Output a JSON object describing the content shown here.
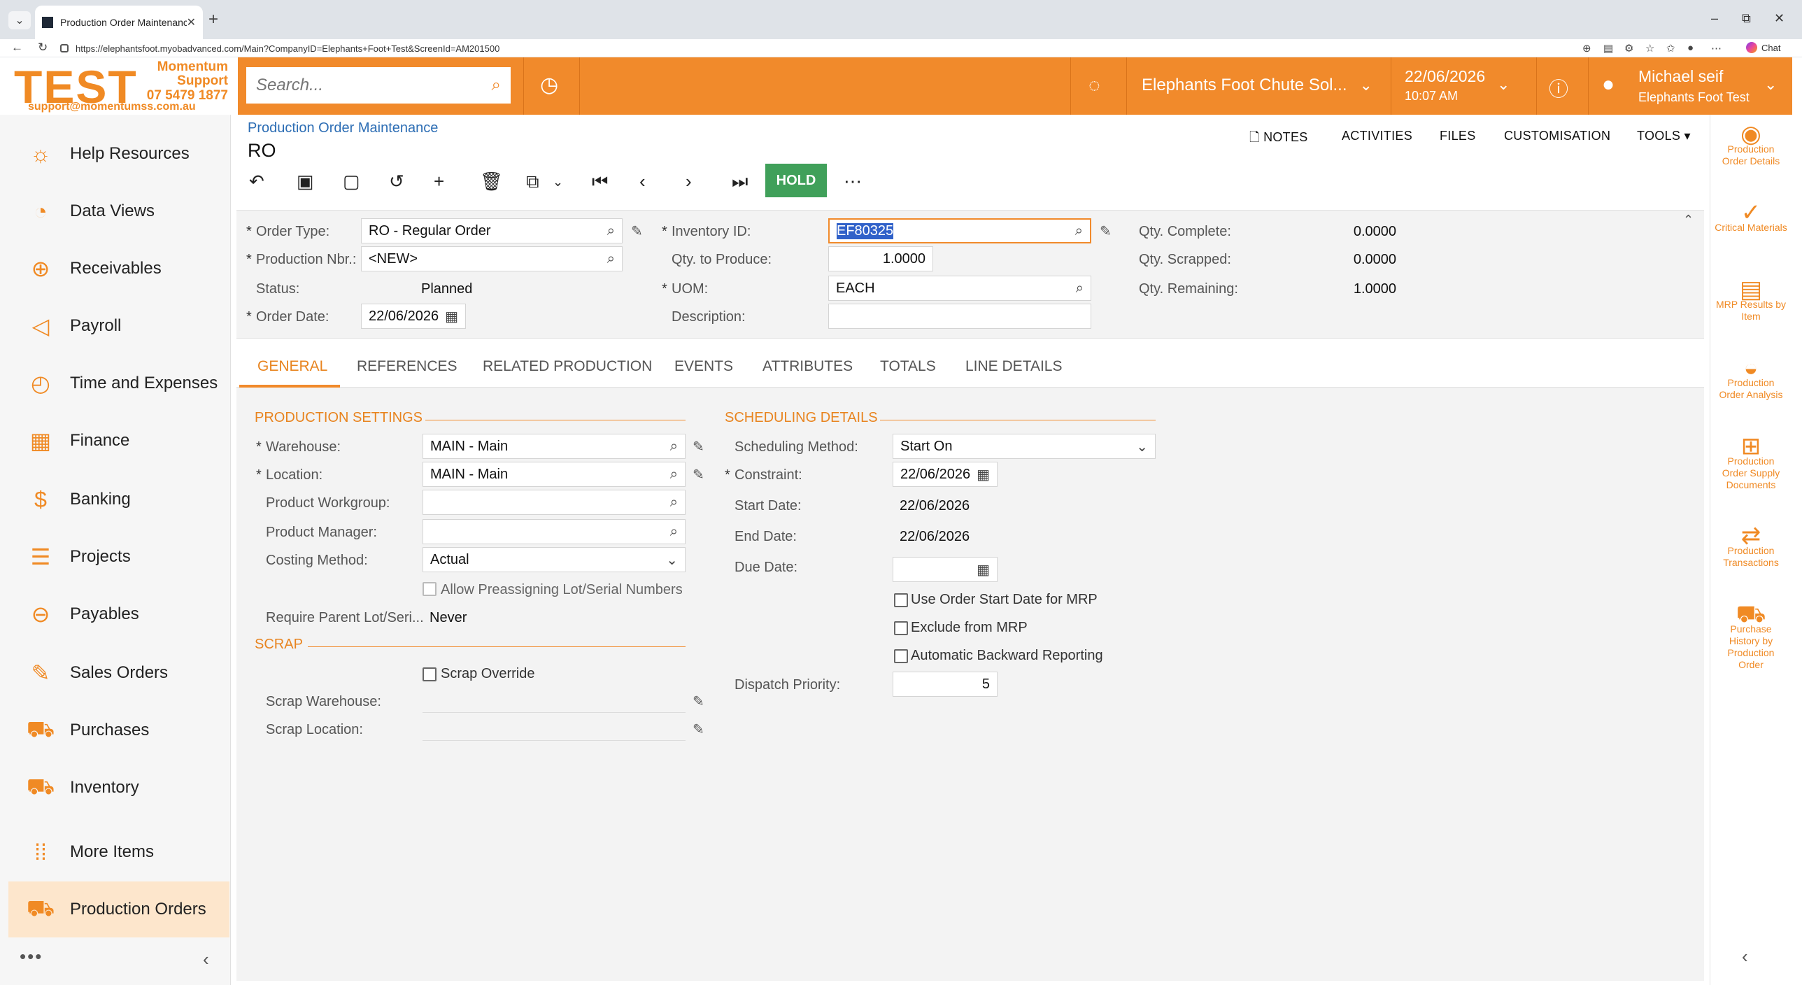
{
  "browser": {
    "tab_title": "Production Order Maintenance",
    "url": "https://elephantsfoot.myobadvanced.com/Main?CompanyID=Elephants+Foot+Test&ScreenId=AM201500",
    "chat_label": "Chat"
  },
  "logo": {
    "brand": "TEST",
    "line1": "Momentum",
    "line2": "Support",
    "phone": "07 5479 1877",
    "email": "support@momentumss.com.au"
  },
  "header": {
    "search_placeholder": "Search...",
    "company": "Elephants Foot Chute Sol...",
    "date": "22/06/2026",
    "time": "10:07 AM",
    "user_name": "Michael seif",
    "user_company": "Elephants Foot Test"
  },
  "sidebar": {
    "items": [
      {
        "label": "Help Resources",
        "icon": "lightbulb-icon"
      },
      {
        "label": "Data Views",
        "icon": "pie-chart-icon"
      },
      {
        "label": "Receivables",
        "icon": "plus-circle-icon"
      },
      {
        "label": "Payroll",
        "icon": "megaphone-icon"
      },
      {
        "label": "Time and Expenses",
        "icon": "stopwatch-icon"
      },
      {
        "label": "Finance",
        "icon": "calculator-icon"
      },
      {
        "label": "Banking",
        "icon": "dollar-icon"
      },
      {
        "label": "Projects",
        "icon": "projects-icon"
      },
      {
        "label": "Payables",
        "icon": "minus-circle-icon"
      },
      {
        "label": "Sales Orders",
        "icon": "edit-icon"
      },
      {
        "label": "Purchases",
        "icon": "cart-icon"
      },
      {
        "label": "Inventory",
        "icon": "truck-icon"
      },
      {
        "label": "More Items",
        "icon": "grid-icon"
      },
      {
        "label": "Production Orders",
        "icon": "truck-icon"
      }
    ],
    "more": "•••"
  },
  "page": {
    "breadcrumb": "Production Order Maintenance",
    "title": "RO",
    "links": {
      "notes": "NOTES",
      "activities": "ACTIVITIES",
      "files": "FILES",
      "customisation": "CUSTOMISATION",
      "tools": "TOOLS"
    },
    "hold_label": "HOLD"
  },
  "summary": {
    "order_type_label": "Order Type:",
    "order_type": "RO - Regular Order",
    "production_nbr_label": "Production Nbr.:",
    "production_nbr": "<NEW>",
    "status_label": "Status:",
    "status": "Planned",
    "order_date_label": "Order Date:",
    "order_date": "22/06/2026",
    "inventory_id_label": "Inventory ID:",
    "inventory_id": "EF80325",
    "qty_to_produce_label": "Qty. to Produce:",
    "qty_to_produce": "1.0000",
    "uom_label": "UOM:",
    "uom": "EACH",
    "description_label": "Description:",
    "description": "",
    "qty_complete_label": "Qty. Complete:",
    "qty_complete": "0.0000",
    "qty_scrapped_label": "Qty. Scrapped:",
    "qty_scrapped": "0.0000",
    "qty_remaining_label": "Qty. Remaining:",
    "qty_remaining": "1.0000"
  },
  "tabs": [
    "GENERAL",
    "REFERENCES",
    "RELATED PRODUCTION",
    "EVENTS",
    "ATTRIBUTES",
    "TOTALS",
    "LINE DETAILS"
  ],
  "production_settings": {
    "header": "PRODUCTION SETTINGS",
    "warehouse_label": "Warehouse:",
    "warehouse": "MAIN - Main",
    "location_label": "Location:",
    "location": "MAIN - Main",
    "workgroup_label": "Product Workgroup:",
    "workgroup": "",
    "manager_label": "Product Manager:",
    "manager": "",
    "costing_label": "Costing Method:",
    "costing": "Actual",
    "preassign_label": "Allow Preassigning Lot/Serial Numbers",
    "require_parent_label": "Require Parent Lot/Seri...",
    "require_parent": "Never"
  },
  "scrap": {
    "header": "SCRAP",
    "override_label": "Scrap Override",
    "warehouse_label": "Scrap Warehouse:",
    "location_label": "Scrap Location:"
  },
  "scheduling": {
    "header": "SCHEDULING DETAILS",
    "method_label": "Scheduling Method:",
    "method": "Start On",
    "constraint_label": "Constraint:",
    "constraint": "22/06/2026",
    "start_label": "Start Date:",
    "start": "22/06/2026",
    "end_label": "End Date:",
    "end": "22/06/2026",
    "due_label": "Due Date:",
    "due": "",
    "use_start_mrp_label": "Use Order Start Date for MRP",
    "exclude_mrp_label": "Exclude from MRP",
    "auto_backward_label": "Automatic Backward Reporting",
    "dispatch_label": "Dispatch Priority:",
    "dispatch": "5"
  },
  "right_panel": [
    {
      "label": "Production Order Details",
      "icon": "eye-icon"
    },
    {
      "label": "Critical Materials",
      "icon": "check-circle-icon"
    },
    {
      "label": "MRP Results by Item",
      "icon": "document-icon"
    },
    {
      "label": "Production Order Analysis",
      "icon": "gauge-icon"
    },
    {
      "label": "Production Order Supply Documents",
      "icon": "hierarchy-icon"
    },
    {
      "label": "Production Transactions",
      "icon": "transfer-icon"
    },
    {
      "label": "Purchase History by Production Order",
      "icon": "cart-icon"
    }
  ],
  "colors": {
    "accent": "#f18a2b",
    "link": "#2c6db4",
    "hold": "#40a05a"
  }
}
